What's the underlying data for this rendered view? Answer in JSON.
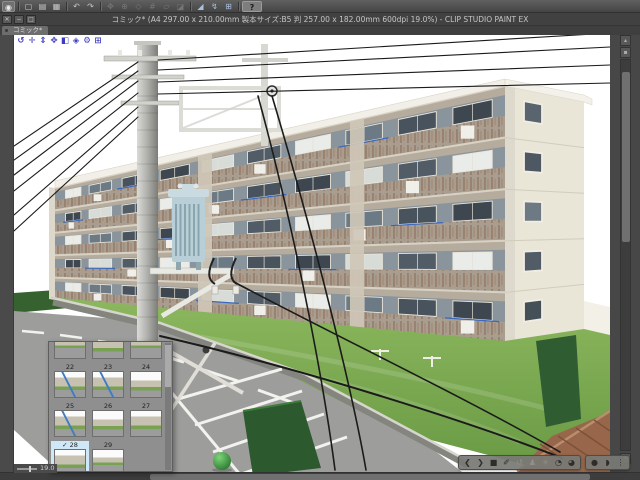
{
  "app": {
    "title_bar": "コミック* (A4 297.00 x 210.00mm 製本サイズ:B5 判 257.00 x 182.00mm 600dpi 19.0%)  - CLIP STUDIO PAINT EX",
    "name": "CLIP STUDIO PAINT EX"
  },
  "window_controls": [
    {
      "name": "close",
      "glyph": "✕"
    },
    {
      "name": "minimize",
      "glyph": "−"
    },
    {
      "name": "maximize",
      "glyph": "□"
    }
  ],
  "main_toolbar": {
    "icons": [
      {
        "name": "clip-studio-logo",
        "glyph": "◉"
      },
      {
        "name": "new-file",
        "glyph": "▢"
      },
      {
        "name": "open-file",
        "glyph": "▤"
      },
      {
        "name": "save-file",
        "glyph": "▦"
      },
      {
        "name": "undo",
        "glyph": "↶"
      },
      {
        "name": "redo",
        "glyph": "↷"
      },
      {
        "name": "free-transform",
        "glyph": "✥"
      },
      {
        "name": "scale-rotate",
        "glyph": "⊕"
      },
      {
        "name": "rotate",
        "glyph": "◇"
      },
      {
        "name": "mesh-transform",
        "glyph": "#"
      },
      {
        "name": "flip-horizontal",
        "glyph": "▱"
      },
      {
        "name": "fill-tool",
        "glyph": "◪"
      },
      {
        "name": "snap-to-ruler",
        "glyph": "◢"
      },
      {
        "name": "snap-to-special-ruler",
        "glyph": "↯"
      },
      {
        "name": "snap-to-grid",
        "glyph": "⊞"
      },
      {
        "name": "help",
        "glyph": "?"
      }
    ]
  },
  "document_tab": {
    "label": "コミック*"
  },
  "object_toolbar": {
    "icons": [
      {
        "name": "camera-rotate",
        "glyph": "↺"
      },
      {
        "name": "camera-pan",
        "glyph": "✛"
      },
      {
        "name": "camera-zoom",
        "glyph": "⇕"
      },
      {
        "name": "object-move-flat",
        "glyph": "✥"
      },
      {
        "name": "object-rotate-3d",
        "glyph": "◧"
      },
      {
        "name": "object-pan-3d",
        "glyph": "◈"
      },
      {
        "name": "snap-3d",
        "glyph": "⚙"
      },
      {
        "name": "object-list",
        "glyph": "⊞"
      }
    ]
  },
  "thumbnail_panel": {
    "checkmark": "✓",
    "items": [
      {
        "label": ""
      },
      {
        "label": ""
      },
      {
        "label": ""
      },
      {
        "label": "22"
      },
      {
        "label": "23"
      },
      {
        "label": "24"
      },
      {
        "label": "25"
      },
      {
        "label": "26"
      },
      {
        "label": "27"
      },
      {
        "label": "28",
        "selected": true
      },
      {
        "label": "29"
      }
    ]
  },
  "bottom_toolbar": {
    "left_icons": [
      {
        "name": "previous-pose",
        "glyph": "❮"
      },
      {
        "name": "next-pose",
        "glyph": "❯"
      },
      {
        "name": "stop",
        "glyph": "■"
      },
      {
        "name": "edit-pose",
        "glyph": "✐"
      },
      {
        "name": "rotate-joint",
        "glyph": "↺"
      },
      {
        "name": "move-character",
        "glyph": "♟"
      },
      {
        "name": "fix-pose",
        "glyph": "✳"
      },
      {
        "name": "camera-orbit-horizontal",
        "glyph": "◔"
      },
      {
        "name": "camera-orbit-vertical",
        "glyph": "◕"
      }
    ],
    "right_icons": [
      {
        "name": "root-manipulator",
        "glyph": "●"
      },
      {
        "name": "pose-material",
        "glyph": "◗"
      },
      {
        "name": "drag-handle",
        "glyph": "⋮"
      }
    ]
  },
  "status": {
    "zoom_value": "19.0"
  },
  "colors": {
    "selection_highlight": "#cfe8f8",
    "toolbar_background": "#4f4f4f",
    "canvas_white": "#ffffff",
    "object_icon_blue": "#3c3cc0",
    "laundry_pole_blue": "#2f62c4",
    "lawn_green": "#7aa84f",
    "hedge_green": "#2e5c30",
    "road_gray": "#9d9d9c",
    "roof_brown": "#97664b",
    "transformer_blue": "#b9cfd7"
  }
}
